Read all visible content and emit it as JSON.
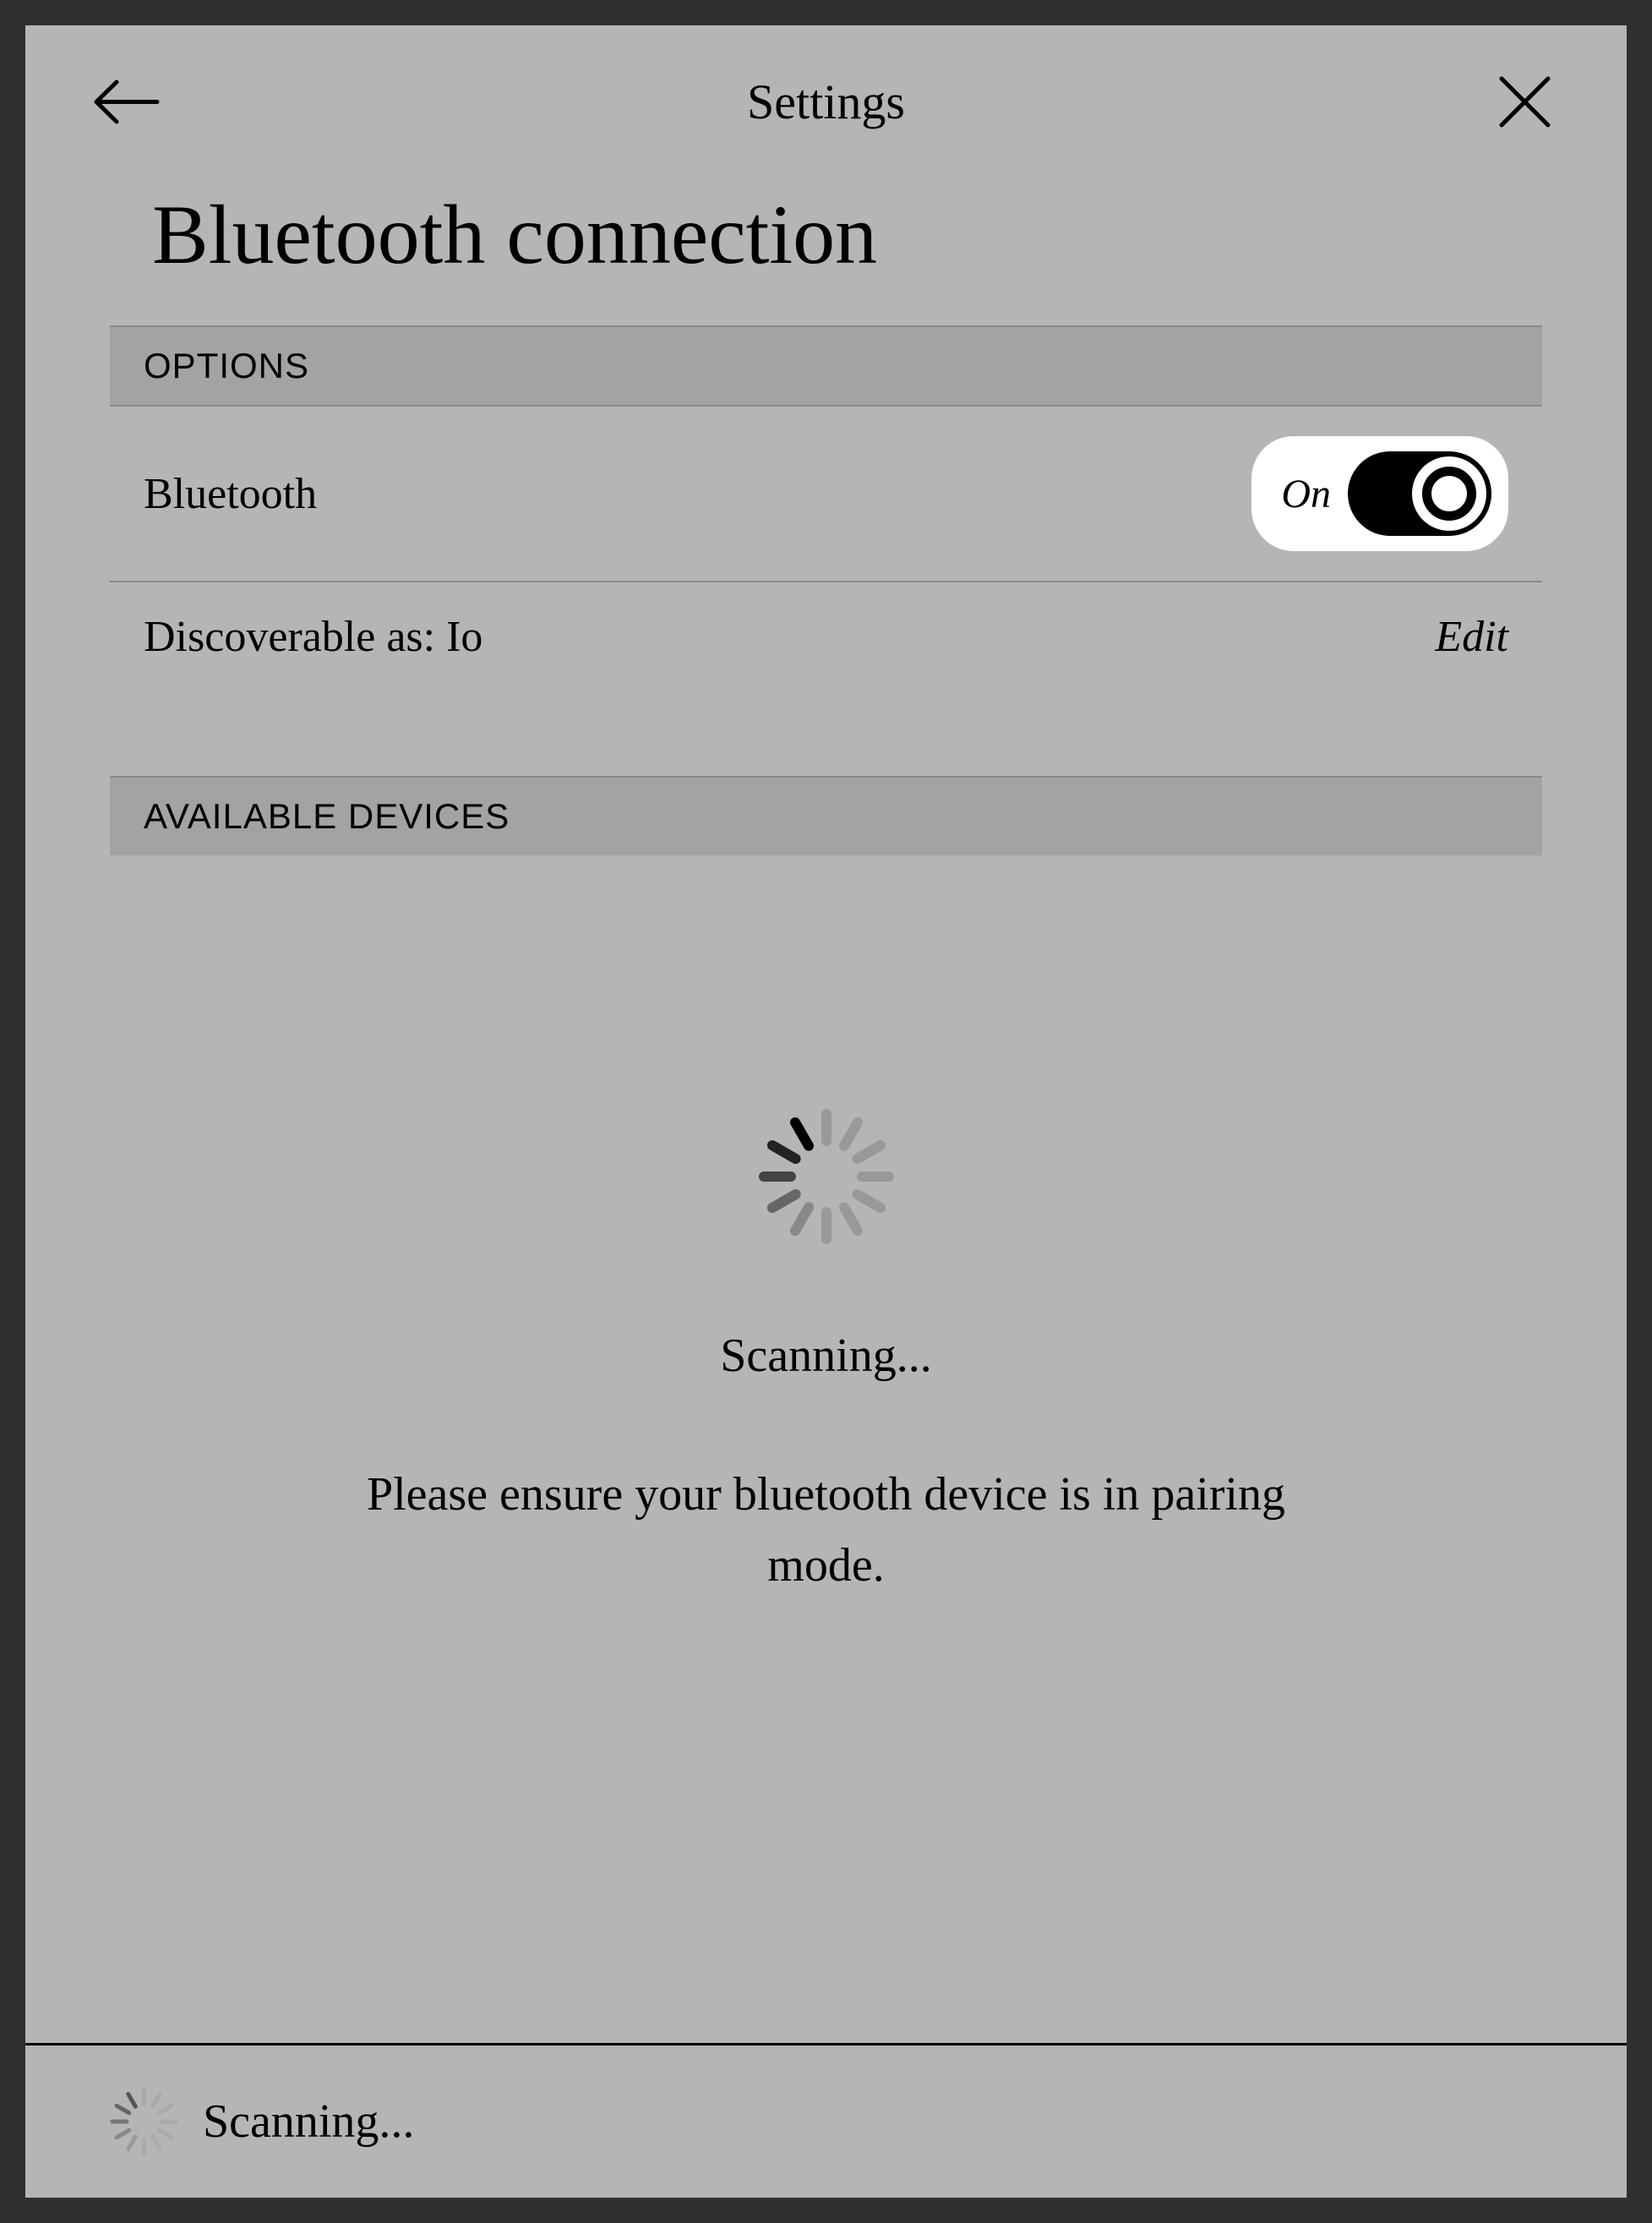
{
  "header": {
    "title": "Settings"
  },
  "page": {
    "title": "Bluetooth connection"
  },
  "sections": {
    "options": {
      "header": "OPTIONS",
      "bluetooth": {
        "label": "Bluetooth",
        "state": "On"
      },
      "discoverable": {
        "label": "Discoverable as: Io",
        "edit": "Edit"
      }
    },
    "devices": {
      "header": "AVAILABLE DEVICES",
      "scanning": {
        "status": "Scanning...",
        "hint": "Please ensure your bluetooth device is in pairing mode."
      }
    }
  },
  "footer": {
    "status": "Scanning..."
  }
}
